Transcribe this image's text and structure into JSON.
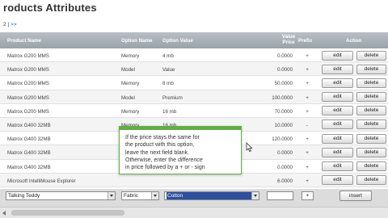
{
  "page": {
    "title": "roducts Attributes"
  },
  "pager": {
    "current": "2",
    "sep": " | ",
    "next": ">>"
  },
  "table": {
    "headers": {
      "product_name": "Product Name",
      "option_name": "Option Name",
      "option_value": "Option Value",
      "value_price": "Value Price",
      "prefix": "Prefix",
      "action": "Action"
    },
    "rows": [
      {
        "product": "Matrox G200 MMS",
        "option": "Memory",
        "value": "4 mb",
        "price": "0.0000",
        "prefix": "+"
      },
      {
        "product": "Matrox G200 MMS",
        "option": "Model",
        "value": "Value",
        "price": "0.0000",
        "prefix": "+"
      },
      {
        "product": "Matrox G200 MMS",
        "option": "Memory",
        "value": "8 mb",
        "price": "50.0000",
        "prefix": "+"
      },
      {
        "product": "Matrox G200 MMS",
        "option": "Model",
        "value": "Premium",
        "price": "100.0000",
        "prefix": "+"
      },
      {
        "product": "Matrox G200 MMS",
        "option": "Memory",
        "value": "16 mb",
        "price": "70.0000",
        "prefix": "+"
      },
      {
        "product": "Matrox G400 32MB",
        "option": "Memory",
        "value": "16 mb",
        "price": "10.0000",
        "prefix": "-"
      },
      {
        "product": "Matrox G400 32MB",
        "option": "",
        "value": "",
        "price": "120.0000",
        "prefix": "+"
      },
      {
        "product": "Matrox G400 32MB",
        "option": "",
        "value": "",
        "price": "0.0000",
        "prefix": "+"
      },
      {
        "product": "Matrox G400 32MB",
        "option": "",
        "value": "",
        "price": "0.0000",
        "prefix": "+"
      },
      {
        "product": "Microsoft IntelliMouse Explorer",
        "option": "",
        "value": "",
        "price": "6.0000",
        "prefix": "+"
      }
    ],
    "edit_label": "edit",
    "delete_label": "delete"
  },
  "tooltip": {
    "line1": "If the price stays the same for",
    "line2": "the product with this option,",
    "line3": "leave the next field blank.",
    "line4a": "Otherwise, enter the ",
    "line4b": "difference",
    "line5": "in price followed by a + or - sign"
  },
  "add_form": {
    "product_select": "Talking Teddy",
    "option_select": "Fabric",
    "value_select": "Cotton",
    "price_input": "",
    "prefix_input": "+",
    "insert_label": "insert"
  },
  "colors": {
    "tooltip_border": "#5fb043",
    "header_bg": "#a8b0b8",
    "selected_bg": "#2c4fa0"
  }
}
